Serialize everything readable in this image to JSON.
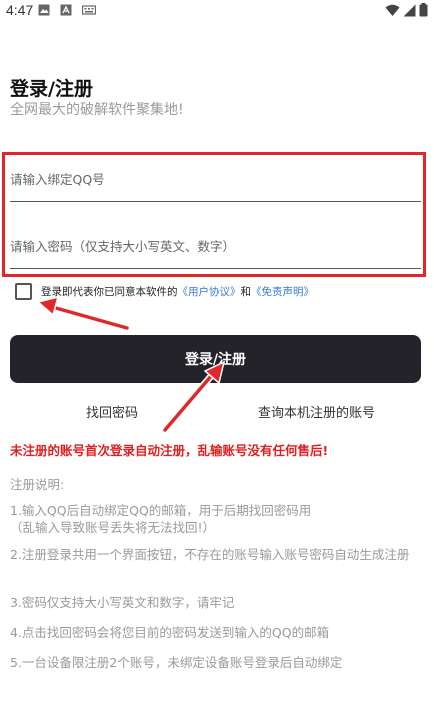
{
  "status_bar": {
    "time": "4:47"
  },
  "header": {
    "title": "登录/注册",
    "subtitle": "全网最大的破解软件聚集地!"
  },
  "form": {
    "qq_placeholder": "请输入绑定QQ号",
    "password_placeholder": "请输入密码（仅支持大小写英文、数字）"
  },
  "agreement": {
    "prefix": "登录即代表你已同意本软件的",
    "user_agreement": "《用户协议》",
    "and": "和",
    "disclaimer": "《免责声明》"
  },
  "actions": {
    "login_label": "登录/注册",
    "find_password": "找回密码",
    "query_account": "查询本机注册的账号"
  },
  "warning": "未注册的账号首次登录自动注册，乱输账号没有任何售后!",
  "notes": {
    "title": "注册说明:",
    "items": [
      "1.输入QQ后自动绑定QQ的邮箱，用于后期找回密码用\n（乱输入导致账号丢失将无法找回!）",
      "2.注册登录共用一个界面按钮，不存在的账号输入账号密码自动生成注册",
      "3.密码仅支持大小写英文和数字，请牢记",
      "4.点击找回密码会将您目前的密码发送到输入的QQ的邮箱",
      "5.一台设备限注册2个账号，未绑定设备账号登录后自动绑定"
    ]
  },
  "colors": {
    "accent_red": "#e0282b",
    "button_dark": "#24232a",
    "link_blue": "#3a7bd5"
  }
}
